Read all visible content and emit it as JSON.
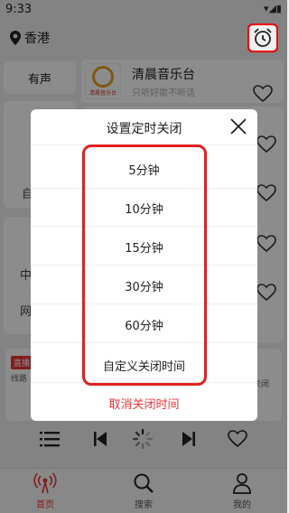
{
  "status_bar": {
    "time": "9:33",
    "icons": "▾◢▮"
  },
  "header": {
    "location": "香港"
  },
  "sidebar": {
    "tab_voiced": "有声",
    "frag_1": "自",
    "frag_2": "中",
    "frag_3": "网"
  },
  "station": {
    "name": "清晨音乐台",
    "slogan": "只听好歌不听话",
    "logo_text": "清晨音乐台"
  },
  "player_frag": {
    "badge": "直播",
    "line": "线路",
    "alarm_label": "关闭"
  },
  "dialog": {
    "title": "设置定时关闭",
    "options": [
      "5分钟",
      "10分钟",
      "15分钟",
      "30分钟",
      "60分钟",
      "自定义关闭时间"
    ],
    "cancel": "取消关闭时间"
  },
  "tabs": {
    "home": "首页",
    "search": "搜索",
    "mine": "我的"
  },
  "colors": {
    "accent": "#e33333",
    "highlight_frame": "#e02020"
  }
}
